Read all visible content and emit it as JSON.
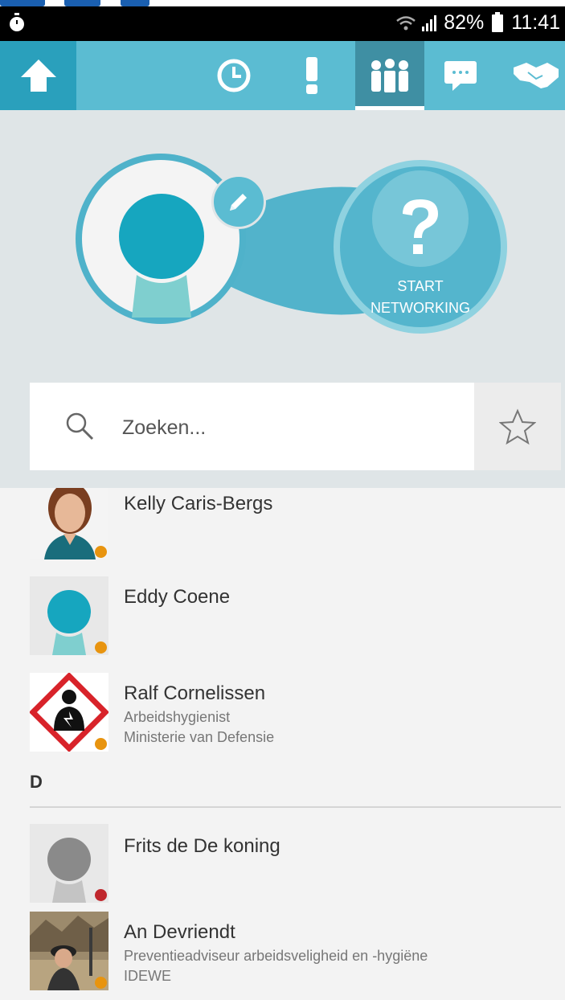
{
  "status_bar": {
    "battery_percent": "82%",
    "time": "11:41"
  },
  "toolbar": {
    "tabs": [
      {
        "icon": "home-icon"
      },
      {
        "icon": "clock-icon"
      },
      {
        "icon": "exclamation-icon"
      },
      {
        "icon": "people-group-icon",
        "active": true
      },
      {
        "icon": "chat-bubble-icon"
      },
      {
        "icon": "handshake-icon"
      }
    ]
  },
  "hero": {
    "edit_icon": "pencil-icon",
    "start_networking_line1": "START",
    "start_networking_line2": "NETWORKING",
    "question_mark": "?"
  },
  "search": {
    "placeholder": "Zoeken...",
    "favorites_icon": "star-outline-icon"
  },
  "contacts": [
    {
      "name": "Kelly Caris-Bergs",
      "title": "",
      "org": "",
      "status": "away"
    },
    {
      "name": "Eddy Coene",
      "title": "",
      "org": "",
      "status": "away"
    },
    {
      "name": "Ralf Cornelissen",
      "title": "Arbeidshygienist",
      "org": "Ministerie van Defensie",
      "status": "away"
    }
  ],
  "section_d": {
    "letter": "D",
    "contacts": [
      {
        "name": "Frits de De koning",
        "title": "",
        "org": "",
        "status": "busy"
      },
      {
        "name": "An Devriendt",
        "title": "Preventieadviseur arbeidsveligheid en -hygiëne",
        "org": "IDEWE",
        "status": "away"
      }
    ]
  },
  "colors": {
    "accent": "#5bbcd2",
    "accent_dark": "#2aa0bc",
    "teal_head": "#15a6bf",
    "away": "#e8940f",
    "busy": "#c0272d"
  }
}
